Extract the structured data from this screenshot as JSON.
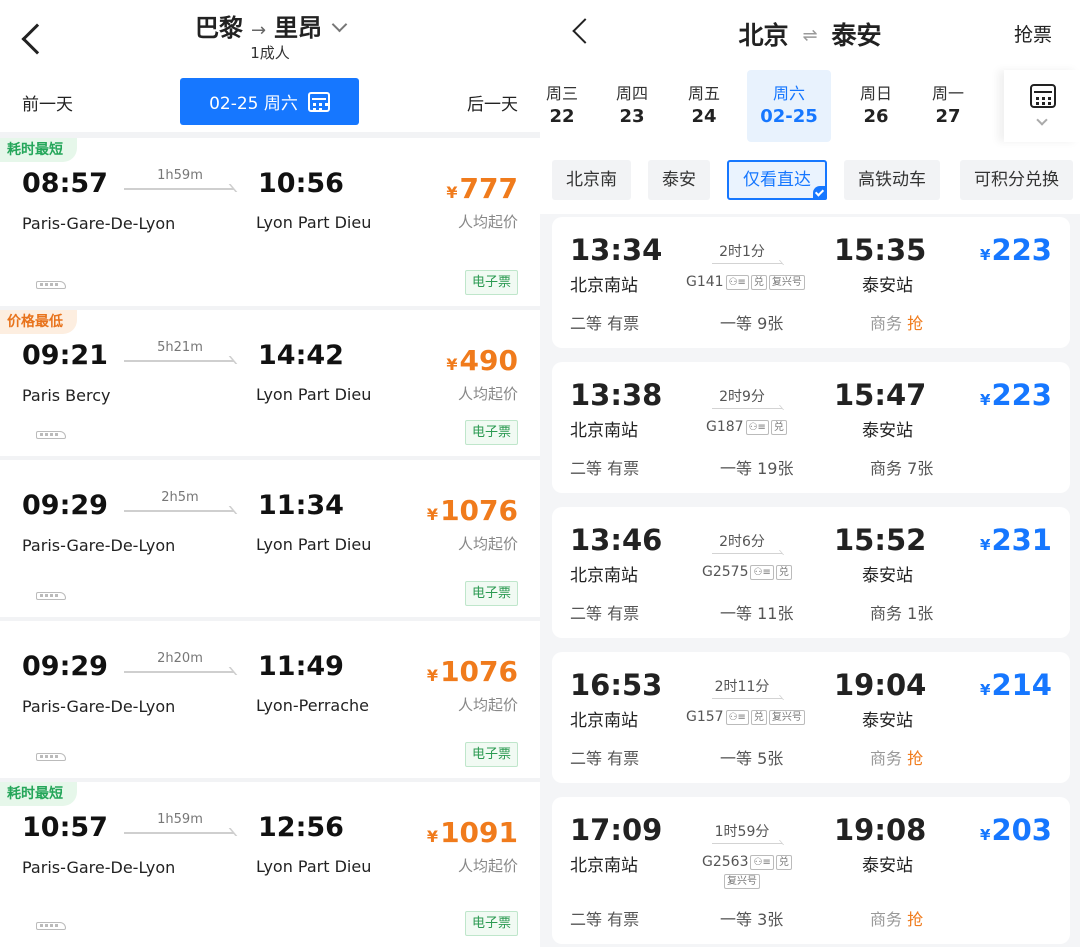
{
  "left": {
    "header": {
      "from": "巴黎",
      "to": "里昂",
      "arrow": "→",
      "passengers": "1成人",
      "prev_day": "前一天",
      "next_day": "后一天",
      "date": "02-25 周六"
    },
    "trains": [
      {
        "tag": "耗时最短",
        "tag_color": "#25a65a",
        "dep_time": "08:57",
        "arr_time": "10:56",
        "duration": "1h59m",
        "dep_station": "Paris-Gare-De-Lyon",
        "arr_station": "Lyon Part Dieu",
        "price": "777",
        "price_unit": "人均起价",
        "eticket": "电子票"
      },
      {
        "tag": "价格最低",
        "tag_color": "#e8731c",
        "dep_time": "09:21",
        "arr_time": "14:42",
        "duration": "5h21m",
        "dep_station": "Paris Bercy",
        "arr_station": "Lyon Part Dieu",
        "price": "490",
        "price_unit": "人均起价",
        "eticket": "电子票"
      },
      {
        "tag": "",
        "dep_time": "09:29",
        "arr_time": "11:34",
        "duration": "2h5m",
        "dep_station": "Paris-Gare-De-Lyon",
        "arr_station": "Lyon Part Dieu",
        "price": "1076",
        "price_unit": "人均起价",
        "eticket": "电子票"
      },
      {
        "tag": "",
        "dep_time": "09:29",
        "arr_time": "11:49",
        "duration": "2h20m",
        "dep_station": "Paris-Gare-De-Lyon",
        "arr_station": "Lyon-Perrache",
        "price": "1076",
        "price_unit": "人均起价",
        "eticket": "电子票"
      },
      {
        "tag": "耗时最短",
        "tag_color": "#25a65a",
        "dep_time": "10:57",
        "arr_time": "12:56",
        "duration": "1h59m",
        "dep_station": "Paris-Gare-De-Lyon",
        "arr_station": "Lyon Part Dieu",
        "price": "1091",
        "price_unit": "人均起价",
        "eticket": "电子票"
      }
    ],
    "currency": "¥"
  },
  "right": {
    "header": {
      "from": "北京",
      "to": "泰安",
      "swap": "⇌",
      "grab_ticket": "抢票"
    },
    "days": [
      {
        "weekday": "周三",
        "day": "22"
      },
      {
        "weekday": "周四",
        "day": "23"
      },
      {
        "weekday": "周五",
        "day": "24"
      },
      {
        "weekday": "周六",
        "day": "02-25",
        "active": true
      },
      {
        "weekday": "周日",
        "day": "26"
      },
      {
        "weekday": "周一",
        "day": "27"
      }
    ],
    "filters": [
      "北京南",
      "泰安",
      "仅看直达",
      "高铁动车",
      "可积分兑换"
    ],
    "badges": {
      "rider": "⚇≡",
      "exchange": "兑",
      "fuxing": "复兴号"
    },
    "currency": "¥",
    "trains": [
      {
        "dep_time": "13:34",
        "arr_time": "15:35",
        "duration": "2时1分",
        "code": "G141",
        "fuxing": true,
        "dep_station": "北京南站",
        "arr_station": "泰安站",
        "price": "223",
        "second": {
          "name": "二等",
          "avail": "有票"
        },
        "first": {
          "name": "一等",
          "avail": "9张"
        },
        "business": {
          "name": "商务",
          "avail": "抢"
        }
      },
      {
        "dep_time": "13:38",
        "arr_time": "15:47",
        "duration": "2时9分",
        "code": "G187",
        "fuxing": false,
        "dep_station": "北京南站",
        "arr_station": "泰安站",
        "price": "223",
        "second": {
          "name": "二等",
          "avail": "有票"
        },
        "first": {
          "name": "一等",
          "avail": "19张"
        },
        "business": {
          "name": "商务",
          "avail": "7张"
        }
      },
      {
        "dep_time": "13:46",
        "arr_time": "15:52",
        "duration": "2时6分",
        "code": "G2575",
        "fuxing": false,
        "dep_station": "北京南站",
        "arr_station": "泰安站",
        "price": "231",
        "second": {
          "name": "二等",
          "avail": "有票"
        },
        "first": {
          "name": "一等",
          "avail": "11张"
        },
        "business": {
          "name": "商务",
          "avail": "1张"
        }
      },
      {
        "dep_time": "16:53",
        "arr_time": "19:04",
        "duration": "2时11分",
        "code": "G157",
        "fuxing": true,
        "dep_station": "北京南站",
        "arr_station": "泰安站",
        "price": "214",
        "second": {
          "name": "二等",
          "avail": "有票"
        },
        "first": {
          "name": "一等",
          "avail": "5张"
        },
        "business": {
          "name": "商务",
          "avail": "抢"
        }
      },
      {
        "dep_time": "17:09",
        "arr_time": "19:08",
        "duration": "1时59分",
        "code": "G2563",
        "fuxing": true,
        "dep_station": "北京南站",
        "arr_station": "泰安站",
        "price": "203",
        "second": {
          "name": "二等",
          "avail": "有票"
        },
        "first": {
          "name": "一等",
          "avail": "3张"
        },
        "business": {
          "name": "商务",
          "avail": "抢"
        }
      }
    ]
  }
}
